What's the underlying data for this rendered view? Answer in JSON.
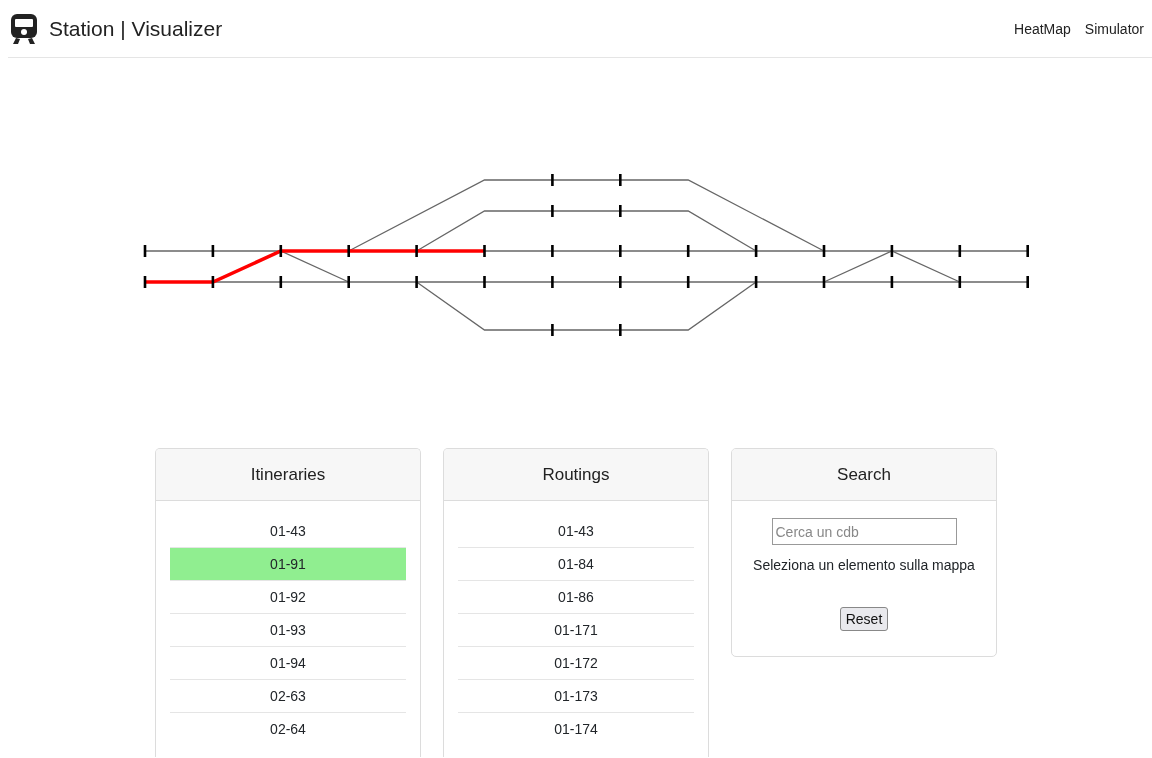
{
  "navbar": {
    "title": "Station | Visualizer",
    "links": [
      "HeatMap",
      "Simulator"
    ]
  },
  "itineraries": {
    "title": "Itineraries",
    "items": [
      {
        "label": "01-43",
        "selected": false
      },
      {
        "label": "01-91",
        "selected": true
      },
      {
        "label": "01-92",
        "selected": false
      },
      {
        "label": "01-93",
        "selected": false
      },
      {
        "label": "01-94",
        "selected": false
      },
      {
        "label": "02-63",
        "selected": false
      },
      {
        "label": "02-64",
        "selected": false
      }
    ]
  },
  "routings": {
    "title": "Routings",
    "items": [
      {
        "label": "01-43",
        "selected": false
      },
      {
        "label": "01-84",
        "selected": false
      },
      {
        "label": "01-86",
        "selected": false
      },
      {
        "label": "01-171",
        "selected": false
      },
      {
        "label": "01-172",
        "selected": false
      },
      {
        "label": "01-173",
        "selected": false
      },
      {
        "label": "01-174",
        "selected": false
      }
    ]
  },
  "search": {
    "title": "Search",
    "placeholder": "Cerca un cdb",
    "message": "Seleziona un elemento sulla mappa",
    "button": "Reset"
  }
}
